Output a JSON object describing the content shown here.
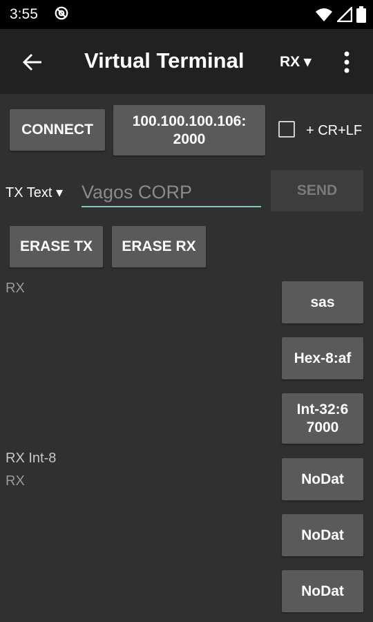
{
  "status": {
    "time": "3:55",
    "icons": [
      "at-sign-icon",
      "wifi-icon",
      "signal-icon",
      "battery-icon"
    ]
  },
  "app_bar": {
    "title": "Virtual Terminal",
    "rx_menu_label": "RX ▾",
    "icons": [
      "back-arrow-icon",
      "overflow-menu-icon"
    ]
  },
  "connection": {
    "connect_label": "CONNECT",
    "address_line1": "100.100.100.106:",
    "address_line2": "2000",
    "crlf_label": "+ CR+LF",
    "crlf_checked": false
  },
  "tx": {
    "mode_label": "TX Text ▾",
    "input_value": "Vagos CORP",
    "send_label": "SEND",
    "erase_tx_label": "ERASE TX",
    "erase_rx_label": "ERASE RX"
  },
  "rx_area": {
    "label_top": "RX",
    "label_int8": "RX Int-8",
    "label_rx2": "RX"
  },
  "side_buttons": [
    {
      "line1": "sas",
      "line2": ""
    },
    {
      "line1": "Hex-8:af",
      "line2": ""
    },
    {
      "line1": "Int-32:6",
      "line2": "7000"
    },
    {
      "line1": "NoDat",
      "line2": ""
    },
    {
      "line1": "NoDat",
      "line2": ""
    },
    {
      "line1": "NoDat",
      "line2": ""
    }
  ],
  "colors": {
    "background": "#303030",
    "app_bar": "#212121",
    "button": "#5a5a5a",
    "accent": "#80cbc4"
  }
}
